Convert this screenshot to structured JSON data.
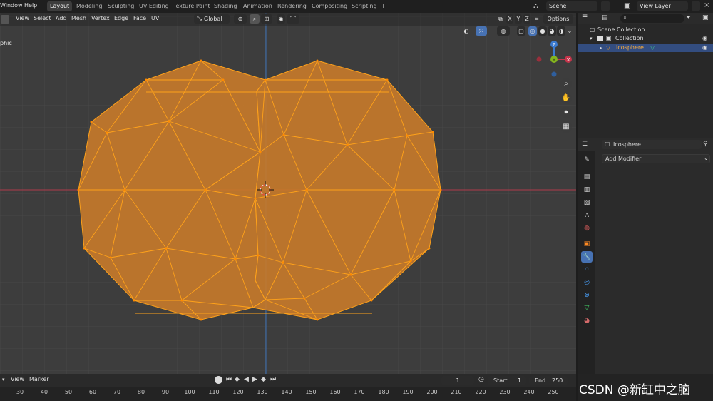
{
  "topbar": {
    "menus": [
      "Window",
      "Help"
    ],
    "workspaces": [
      "Layout",
      "Modeling",
      "Sculpting",
      "UV Editing",
      "Texture Paint",
      "Shading",
      "Animation",
      "Rendering",
      "Compositing",
      "Scripting"
    ],
    "active_workspace": "Layout",
    "add_tab": "+",
    "scene": "Scene",
    "view_layer": "View Layer"
  },
  "viewport": {
    "header": {
      "menus": [
        "View",
        "Select",
        "Add",
        "Mesh",
        "Vertex",
        "Edge",
        "Face",
        "UV"
      ],
      "orientation": "Global",
      "options_label": "Options",
      "axis_toggles": [
        "X",
        "Y",
        "Z"
      ]
    },
    "view_label": "phic",
    "gizmo": {
      "x": "X",
      "y": "Y",
      "z": "Z"
    }
  },
  "outliner": {
    "root": "Scene Collection",
    "collection": "Collection",
    "object": "Icosphere"
  },
  "properties": {
    "object_name": "Icosphere",
    "add_modifier": "Add Modifier"
  },
  "timeline": {
    "menus": [
      "View",
      "Marker"
    ],
    "current_frame": "1",
    "start_label": "Start",
    "start_value": "1",
    "end_label": "End",
    "end_value": "250",
    "ticks": [
      "30",
      "40",
      "50",
      "60",
      "70",
      "80",
      "90",
      "100",
      "110",
      "120",
      "130",
      "140",
      "150",
      "160",
      "170",
      "180",
      "190",
      "200",
      "210",
      "220",
      "230",
      "240",
      "250"
    ]
  },
  "watermark": "CSDN @新缸中之脑",
  "colors": {
    "accent": "#4772b3",
    "mesh_fill": "#c87a2a",
    "mesh_edge": "#ffa21a",
    "x_axis": "#c4344a",
    "y_axis": "#84b41f",
    "z_axis": "#3b7ad0"
  }
}
